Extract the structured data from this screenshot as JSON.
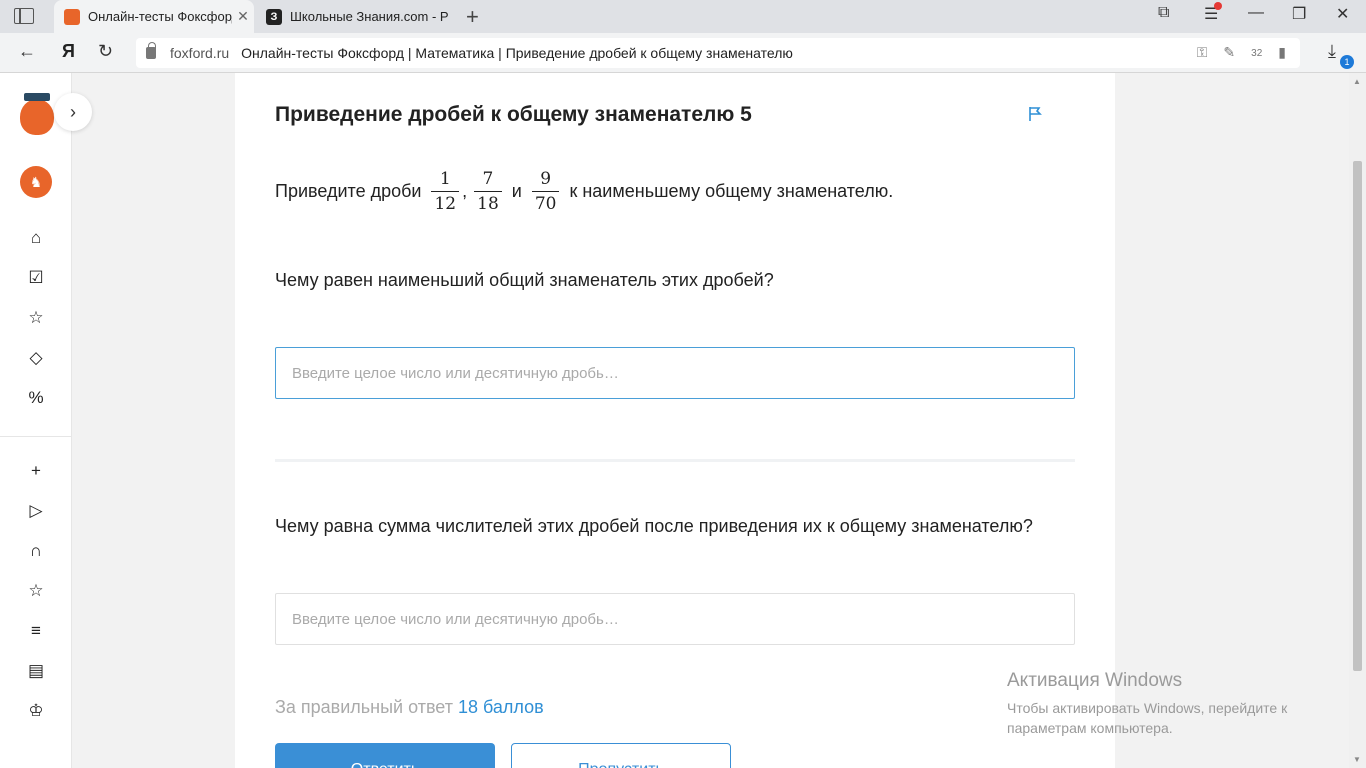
{
  "browser": {
    "tabs": [
      {
        "title": "Онлайн-тесты Фоксфорд",
        "active": true
      },
      {
        "title": "Школьные Знания.com - Р",
        "active": false
      }
    ],
    "url_domain": "foxford.ru",
    "page_title": "Онлайн-тесты Фоксфорд | Математика | Приведение дробей к общему знаменателю",
    "address_icon_letter": "Я",
    "ext_counter": "32",
    "download_badge": "1"
  },
  "task": {
    "title": "Приведение дробей к общему знаменателю 5",
    "statement_prefix": "Приведите дроби",
    "fractions": [
      {
        "num": "1",
        "den": "12"
      },
      {
        "num": "7",
        "den": "18"
      },
      {
        "num": "9",
        "den": "70"
      }
    ],
    "separator": ",",
    "conjunction": "и",
    "statement_suffix": "к наименьшему общему знаменателю.",
    "questions": [
      {
        "text": "Чему равен наименьший общий знаменатель этих дробей?",
        "placeholder": "Введите целое число или десятичную дробь…",
        "value": ""
      },
      {
        "text": "Чему равна сумма числителей этих дробей после приведения их к общему знаменателю?",
        "placeholder": "Введите целое число или десятичную дробь…",
        "value": ""
      }
    ],
    "score_text": "За правильный ответ",
    "score_points": "18 баллов",
    "answer_button": "Ответить",
    "skip_button": "Пропустить"
  },
  "watermark": {
    "title": "Активация Windows",
    "text": "Чтобы активировать Windows, перейдите к параметрам компьютера."
  },
  "colors": {
    "accent": "#3a8fd6",
    "brand": "#e8652a",
    "focus_border": "#4a9fd8"
  }
}
